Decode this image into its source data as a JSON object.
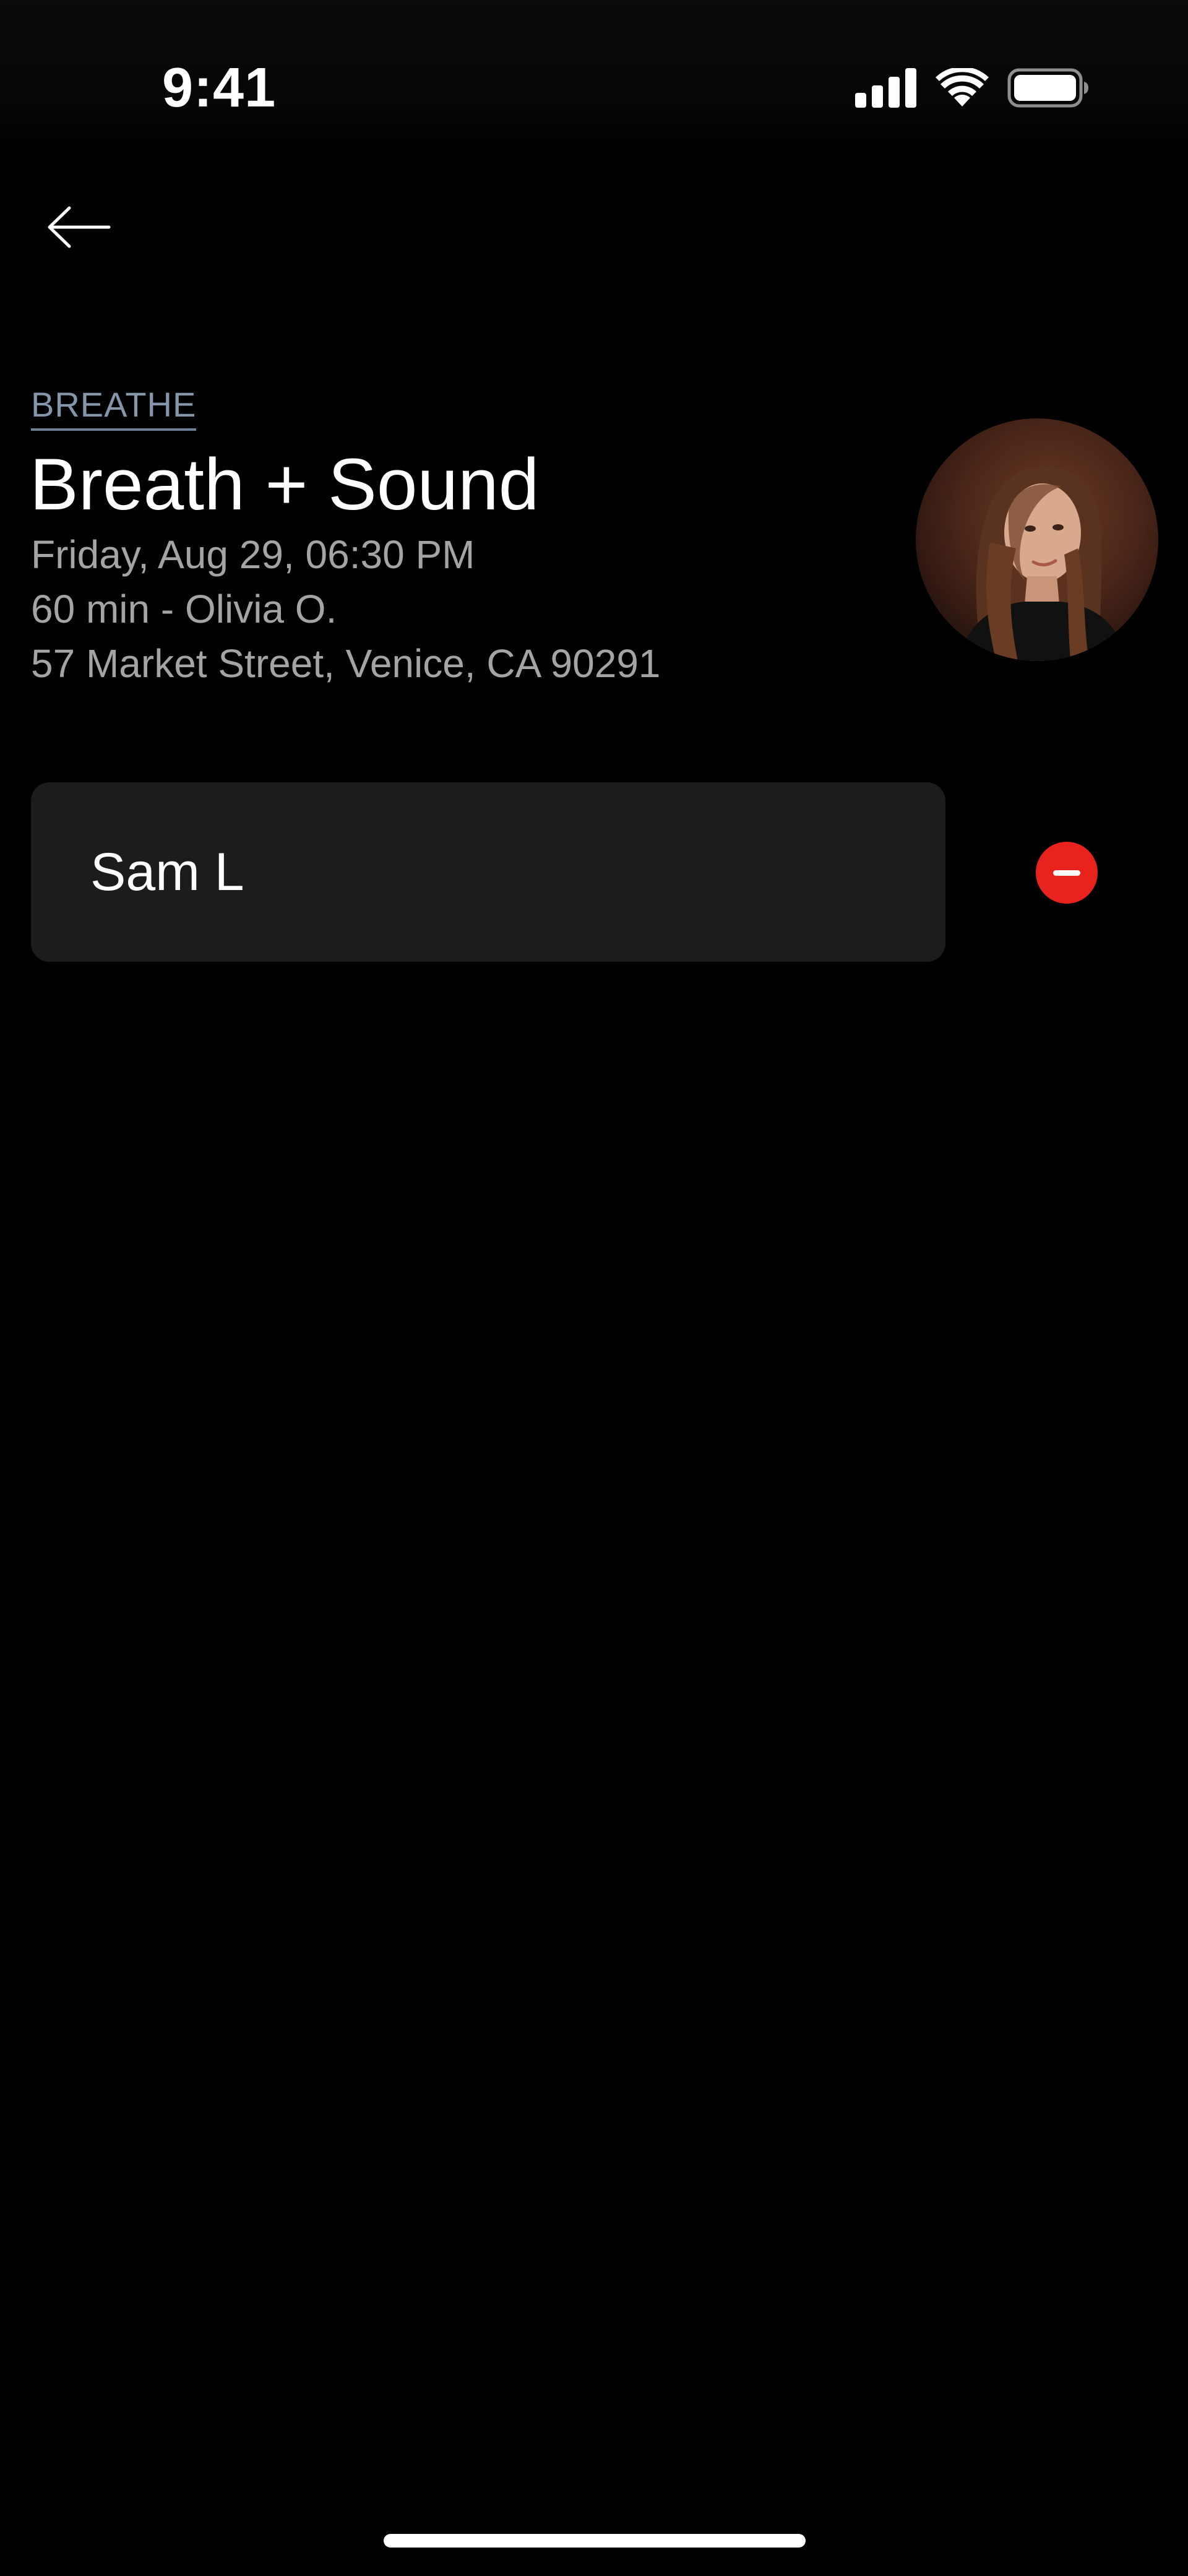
{
  "status_bar": {
    "time": "9:41",
    "icons": [
      "cellular-signal-icon",
      "wifi-icon",
      "battery-icon"
    ]
  },
  "navigation": {
    "back_icon": "arrow-left-icon"
  },
  "class": {
    "category": "BREATHE",
    "title": "Breath + Sound",
    "date_time": "Friday, Aug 29, 06:30 PM",
    "duration_instructor": "60 min - Olivia O.",
    "address": "57 Market Street, Venice, CA 90291"
  },
  "attendees": [
    {
      "name": "Sam L",
      "action_icon": "remove-icon"
    }
  ],
  "colors": {
    "background": "#000000",
    "card": "#1c1c1c",
    "category": "#8696aa",
    "secondary_text": "#a4a4a4",
    "remove": "#e8221c"
  }
}
